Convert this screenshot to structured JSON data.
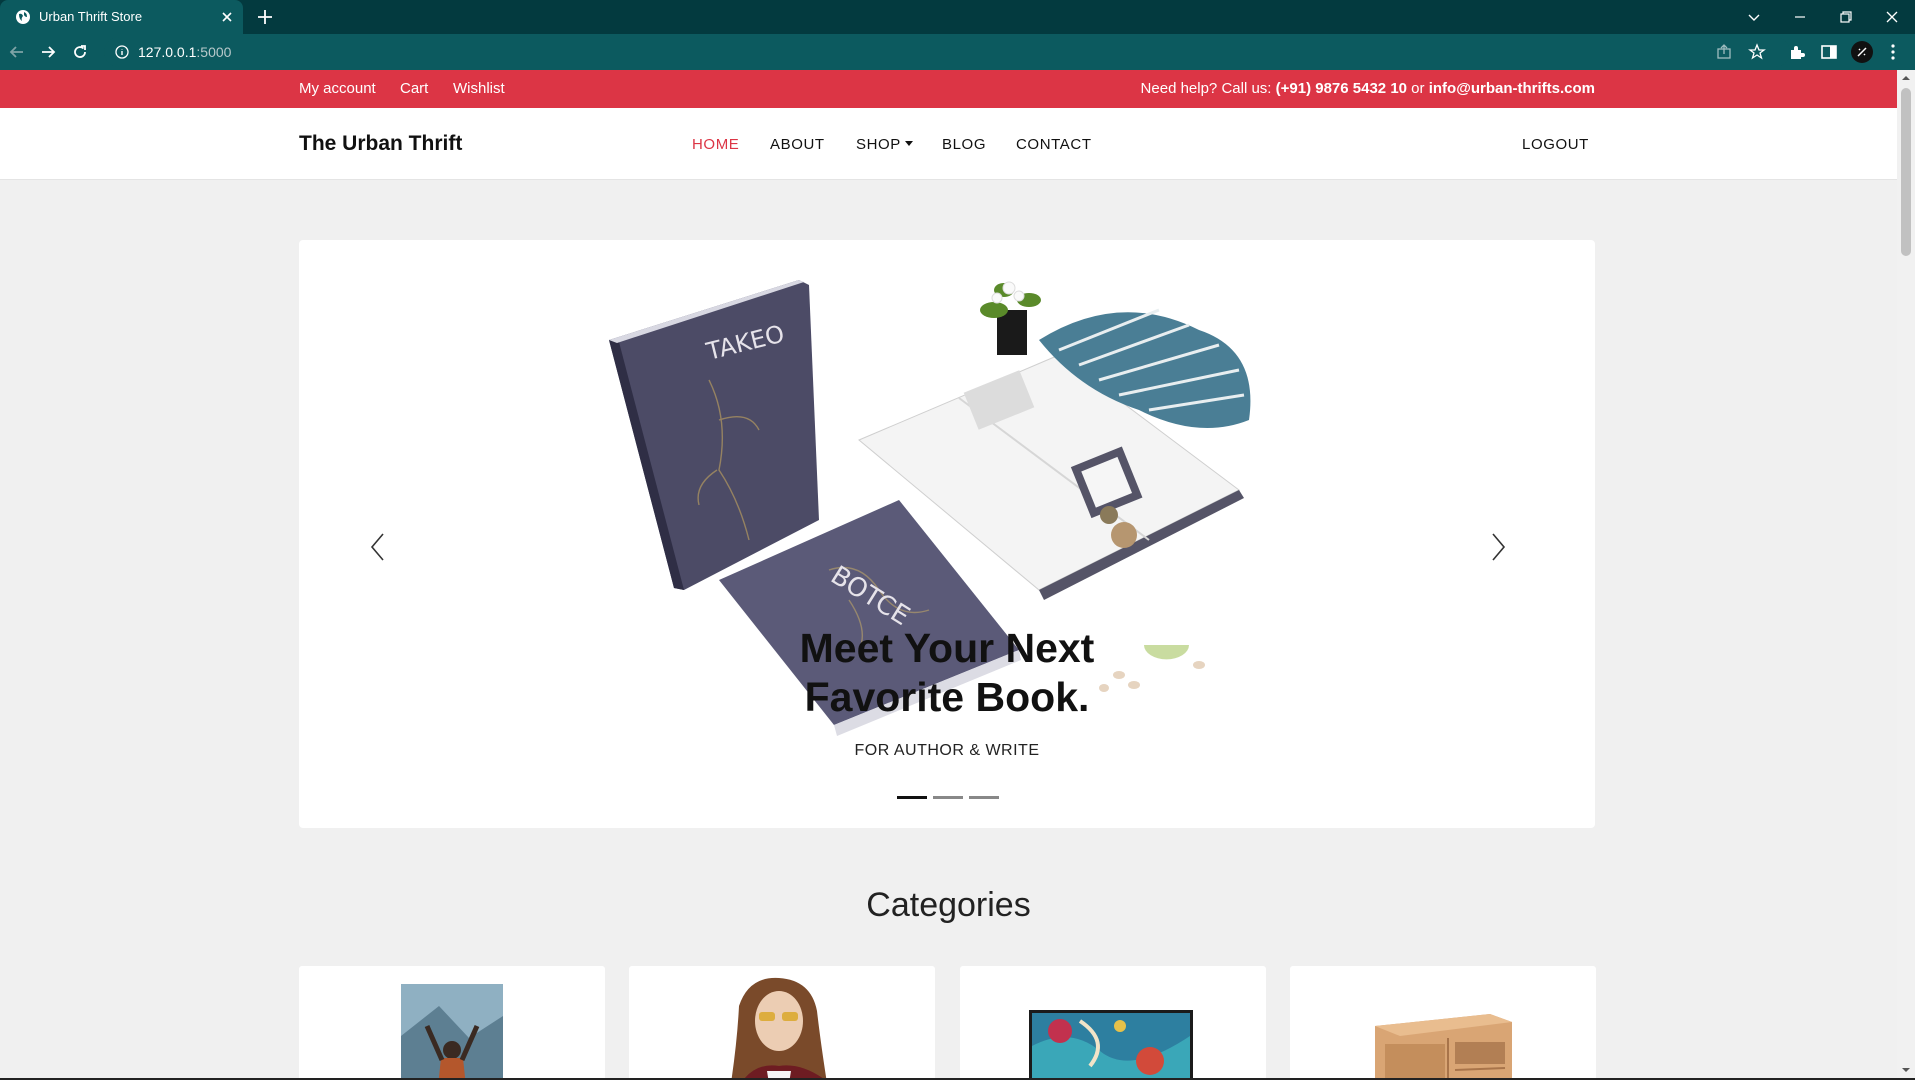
{
  "browser": {
    "tab_title": "Urban Thrift Store",
    "url_host": "127.0.0.1",
    "url_port": ":5000"
  },
  "topbar": {
    "links": [
      "My account",
      "Cart",
      "Wishlist"
    ],
    "help_prefix": "Need help? Call us: ",
    "phone": "(+91) 9876 5432 10",
    "help_or": " or ",
    "email": "info@urban-thrifts.com",
    "bg_color": "#dc3545"
  },
  "navbar": {
    "brand": "The Urban Thrift",
    "items": [
      "HOME",
      "ABOUT",
      "SHOP",
      "BLOG",
      "CONTACT"
    ],
    "active": "HOME",
    "logout": "LOGOUT"
  },
  "hero": {
    "title_line1": "Meet Your Next",
    "title_line2": "Favorite Book.",
    "subtitle": "FOR AUTHOR & WRITE",
    "slide_count": 3,
    "active_slide": 1,
    "book_cover_text_1": "TAKEO",
    "book_cover_text_2": "BOTCE"
  },
  "categories": {
    "heading": "Categories",
    "items": [
      "books-category-image",
      "fashion-category-image",
      "art-category-image",
      "furniture-category-image"
    ]
  }
}
